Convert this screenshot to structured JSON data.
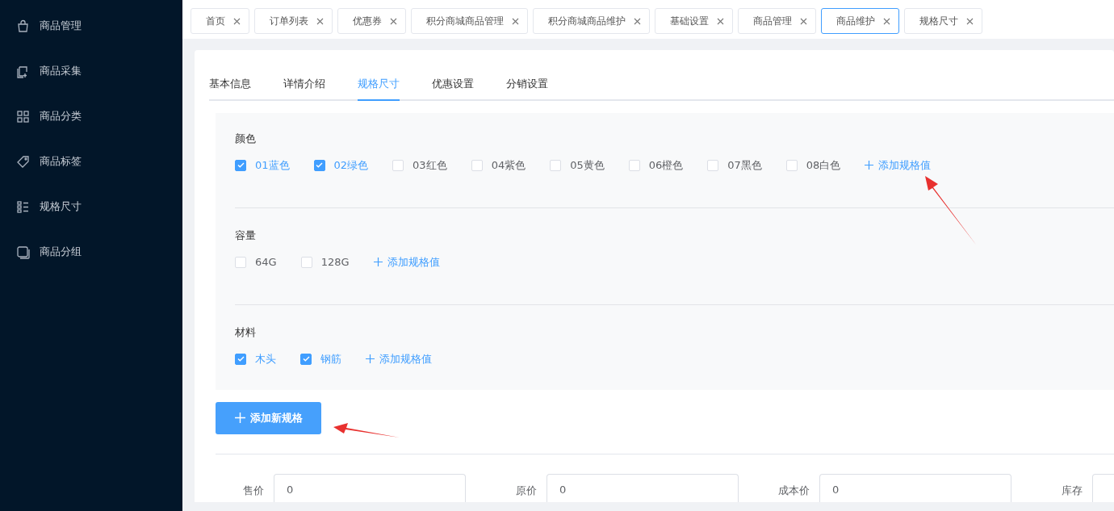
{
  "sidebar": {
    "items": [
      {
        "label": "商品管理"
      },
      {
        "label": "商品采集"
      },
      {
        "label": "商品分类"
      },
      {
        "label": "商品标签"
      },
      {
        "label": "规格尺寸"
      },
      {
        "label": "商品分组"
      }
    ]
  },
  "page_tabs": [
    {
      "label": "首页",
      "selected": false
    },
    {
      "label": "订单列表",
      "selected": false
    },
    {
      "label": "优惠券",
      "selected": false
    },
    {
      "label": "积分商城商品管理",
      "selected": false
    },
    {
      "label": "积分商城商品维护",
      "selected": false
    },
    {
      "label": "基础设置",
      "selected": false
    },
    {
      "label": "商品管理",
      "selected": false
    },
    {
      "label": "商品维护",
      "selected": true
    },
    {
      "label": "规格尺寸",
      "selected": false
    }
  ],
  "form_tabs": [
    {
      "label": "基本信息",
      "selected": false
    },
    {
      "label": "详情介绍",
      "selected": false
    },
    {
      "label": "规格尺寸",
      "selected": true
    },
    {
      "label": "优惠设置",
      "selected": false
    },
    {
      "label": "分销设置",
      "selected": false
    }
  ],
  "spec_groups": [
    {
      "title": "颜色",
      "add_label": "添加规格值",
      "values": [
        {
          "label": "01蓝色",
          "checked": true
        },
        {
          "label": "02绿色",
          "checked": true
        },
        {
          "label": "03红色",
          "checked": false
        },
        {
          "label": "04紫色",
          "checked": false
        },
        {
          "label": "05黄色",
          "checked": false
        },
        {
          "label": "06橙色",
          "checked": false
        },
        {
          "label": "07黑色",
          "checked": false
        },
        {
          "label": "08白色",
          "checked": false
        }
      ]
    },
    {
      "title": "容量",
      "add_label": "添加规格值",
      "values": [
        {
          "label": "64G",
          "checked": false
        },
        {
          "label": "128G",
          "checked": false
        }
      ]
    },
    {
      "title": "材料",
      "add_label": "添加规格值",
      "values": [
        {
          "label": "木头",
          "checked": true
        },
        {
          "label": "钢筋",
          "checked": true
        }
      ]
    }
  ],
  "add_spec_button": "添加新规格",
  "price_fields": [
    {
      "label": "售价",
      "value": "0"
    },
    {
      "label": "原价",
      "value": "0"
    },
    {
      "label": "成本价",
      "value": "0"
    },
    {
      "label": "库存"
    }
  ]
}
